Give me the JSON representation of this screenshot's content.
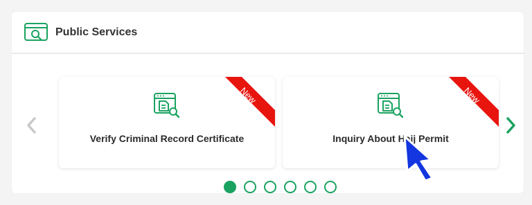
{
  "panel": {
    "title": "Public Services",
    "icon": "search-window-icon"
  },
  "carousel": {
    "prev_icon": "chevron-left-icon",
    "next_icon": "chevron-right-icon",
    "cards": [
      {
        "label": "Verify Criminal Record Certificate",
        "badge": "New",
        "icon": "document-search-icon"
      },
      {
        "label": "Inquiry About Hajj Permit",
        "badge": "New",
        "icon": "document-search-icon"
      }
    ],
    "pages": 6,
    "active_page": 1
  },
  "colors": {
    "accent": "#1aa260",
    "badge": "#e8140e",
    "arrow_disabled": "#c8c8c8",
    "cursor": "#1336e0"
  }
}
